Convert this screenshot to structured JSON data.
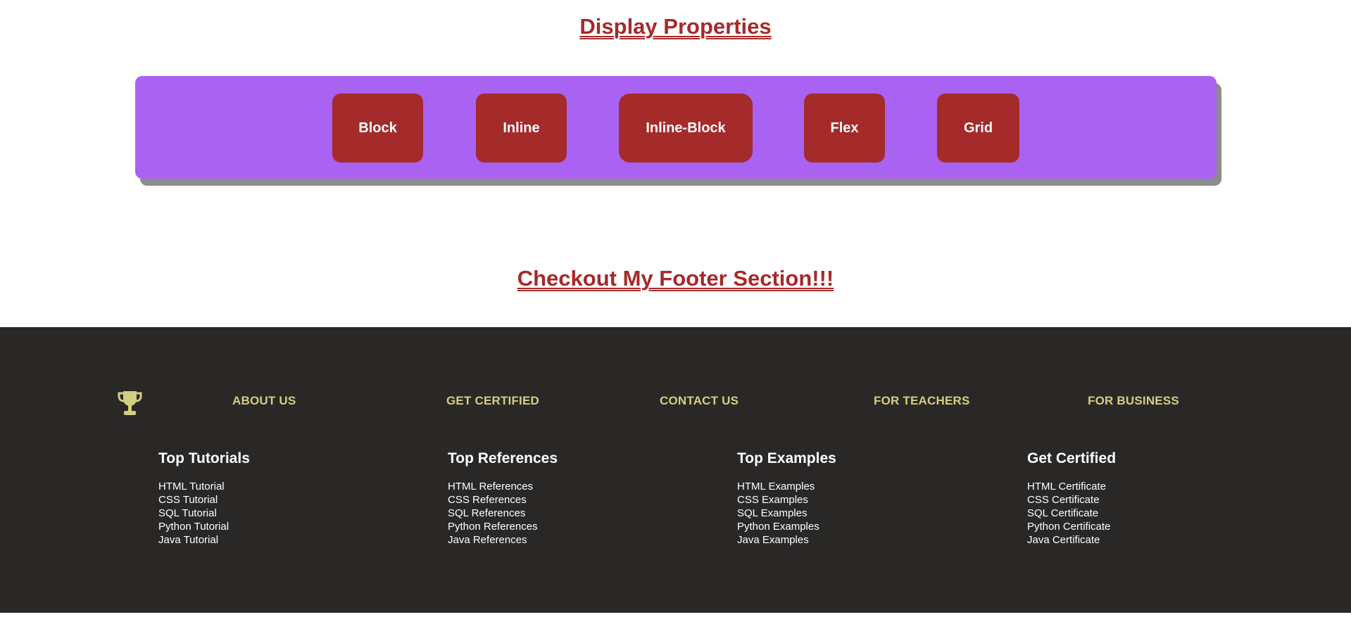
{
  "display_section": {
    "title": "Display Properties",
    "buttons": [
      "Block",
      "Inline",
      "Inline-Block",
      "Flex",
      "Grid"
    ],
    "box_color": "#a962f2",
    "button_color": "#a52a2a"
  },
  "footer_heading": "Checkout My Footer Section!!!",
  "footer": {
    "logo_icon": "trophy-icon",
    "nav": [
      "ABOUT US",
      "GET CERTIFIED",
      "CONTACT US",
      "FOR TEACHERS",
      "FOR BUSINESS"
    ],
    "columns": [
      {
        "heading": "Top Tutorials",
        "links": [
          "HTML Tutorial",
          "CSS Tutorial",
          "SQL Tutorial",
          "Python Tutorial",
          "Java Tutorial"
        ]
      },
      {
        "heading": "Top References",
        "links": [
          "HTML References",
          "CSS References",
          "SQL References",
          "Python References",
          "Java References"
        ]
      },
      {
        "heading": "Top Examples",
        "links": [
          "HTML Examples",
          "CSS Examples",
          "SQL Examples",
          "Python Examples",
          "Java Examples"
        ]
      },
      {
        "heading": "Get Certified",
        "links": [
          "HTML Certificate",
          "CSS Certificate",
          "SQL Certificate",
          "Python Certificate",
          "Java Certificate"
        ]
      }
    ],
    "background": "#2a2827",
    "accent": "#d2cf82"
  }
}
